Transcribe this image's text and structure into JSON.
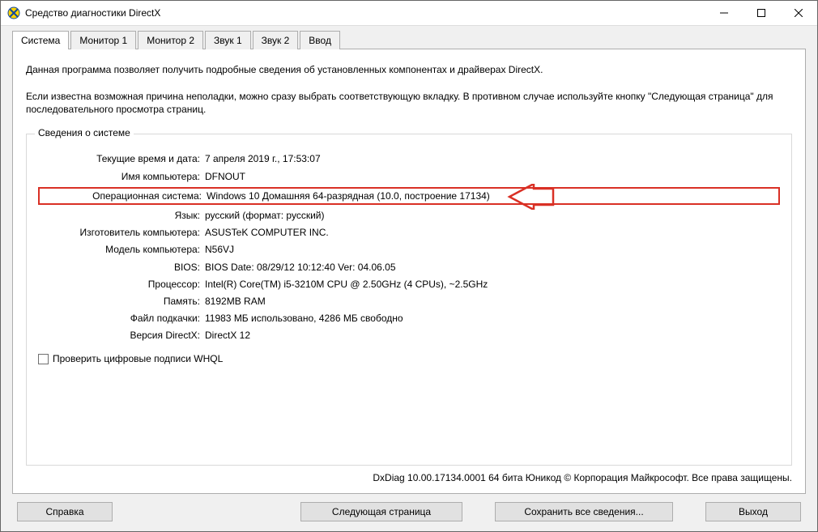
{
  "window": {
    "title": "Средство диагностики DirectX"
  },
  "tabs": [
    {
      "label": "Система"
    },
    {
      "label": "Монитор 1"
    },
    {
      "label": "Монитор 2"
    },
    {
      "label": "Звук 1"
    },
    {
      "label": "Звук 2"
    },
    {
      "label": "Ввод"
    }
  ],
  "intro": {
    "line1": "Данная программа позволяет получить подробные сведения об установленных компонентах и драйверах DirectX.",
    "line2": "Если известна возможная причина неполадки, можно сразу выбрать соответствующую вкладку. В противном случае используйте кнопку \"Следующая страница\" для последовательного просмотра страниц."
  },
  "groupbox_title": "Сведения о системе",
  "rows": [
    {
      "label": "Текущие время и дата:",
      "value": "7 апреля 2019 г., 17:53:07"
    },
    {
      "label": "Имя компьютера:",
      "value": "DFNOUT"
    },
    {
      "label": "Операционная система:",
      "value": "Windows 10 Домашняя 64-разрядная (10.0, построение 17134)"
    },
    {
      "label": "Язык:",
      "value": "русский (формат: русский)"
    },
    {
      "label": "Изготовитель компьютера:",
      "value": "ASUSTeK COMPUTER INC."
    },
    {
      "label": "Модель компьютера:",
      "value": "N56VJ"
    },
    {
      "label": "BIOS:",
      "value": "BIOS Date: 08/29/12 10:12:40 Ver: 04.06.05"
    },
    {
      "label": "Процессор:",
      "value": "Intel(R) Core(TM) i5-3210M CPU @ 2.50GHz (4 CPUs), ~2.5GHz"
    },
    {
      "label": "Память:",
      "value": "8192MB RAM"
    },
    {
      "label": "Файл подкачки:",
      "value": "11983 МБ использовано, 4286 МБ свободно"
    },
    {
      "label": "Версия DirectX:",
      "value": "DirectX 12"
    }
  ],
  "highlight_index": 2,
  "checkbox_label": "Проверить цифровые подписи WHQL",
  "footer": "DxDiag 10.00.17134.0001 64 бита Юникод © Корпорация Майкрософт. Все права защищены.",
  "buttons": {
    "help": "Справка",
    "next": "Следующая страница",
    "save": "Сохранить все сведения...",
    "exit": "Выход"
  },
  "annotation_color": "#d93025"
}
